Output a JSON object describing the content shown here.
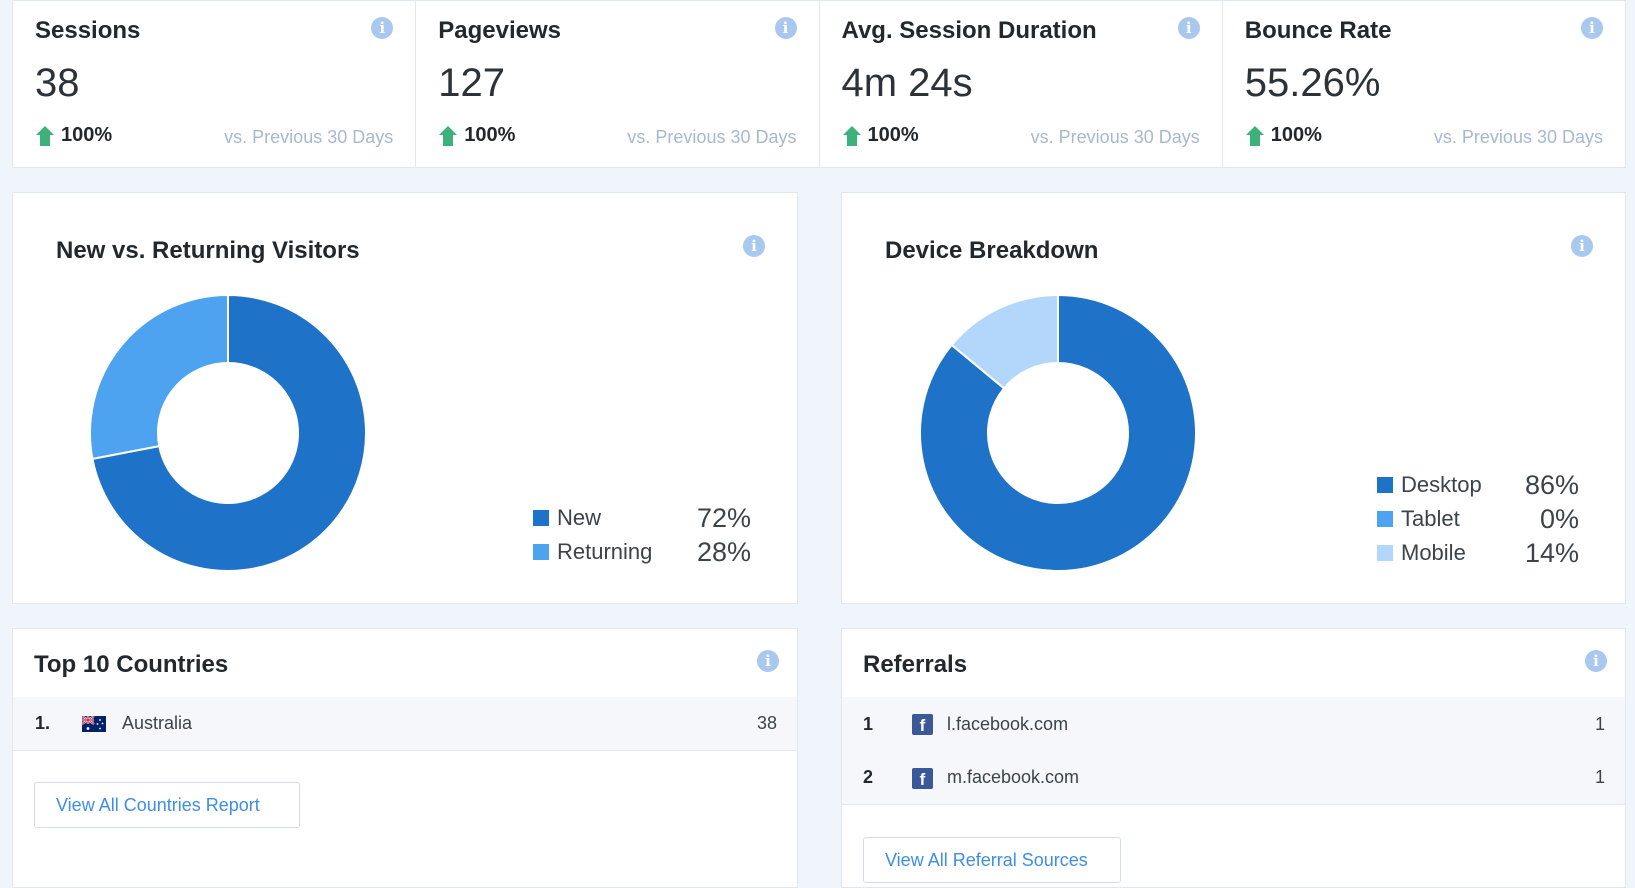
{
  "stats": [
    {
      "title": "Sessions",
      "value": "38",
      "change": "100%",
      "compare": "vs. Previous 30 Days"
    },
    {
      "title": "Pageviews",
      "value": "127",
      "change": "100%",
      "compare": "vs. Previous 30 Days"
    },
    {
      "title": "Avg. Session Duration",
      "value": "4m 24s",
      "change": "100%",
      "compare": "vs. Previous 30 Days"
    },
    {
      "title": "Bounce Rate",
      "value": "55.26%",
      "change": "100%",
      "compare": "vs. Previous 30 Days"
    }
  ],
  "info_icon_glyph": "i",
  "visitors": {
    "title": "New vs. Returning Visitors",
    "legend": [
      {
        "label": "New",
        "pct": "72%",
        "value": 72,
        "color": "#1e73c8"
      },
      {
        "label": "Returning",
        "pct": "28%",
        "value": 28,
        "color": "#4da3f0"
      }
    ]
  },
  "devices": {
    "title": "Device Breakdown",
    "legend": [
      {
        "label": "Desktop",
        "pct": "86%",
        "value": 86,
        "color": "#1e73c8"
      },
      {
        "label": "Tablet",
        "pct": "0%",
        "value": 0,
        "color": "#4da3f0"
      },
      {
        "label": "Mobile",
        "pct": "14%",
        "value": 14,
        "color": "#b3d7fb"
      }
    ]
  },
  "countries": {
    "title": "Top 10 Countries",
    "rows": [
      {
        "index": "1.",
        "name": "Australia",
        "count": "38",
        "flag_icon": "australia-flag-icon"
      }
    ],
    "button": "View All Countries Report"
  },
  "referrals": {
    "title": "Referrals",
    "rows": [
      {
        "index": "1",
        "name": "l.facebook.com",
        "count": "1",
        "icon": "facebook-icon"
      },
      {
        "index": "2",
        "name": "m.facebook.com",
        "count": "1",
        "icon": "facebook-icon"
      }
    ],
    "button": "View All Referral Sources"
  },
  "facebook_glyph": "f",
  "colors": {
    "accent": "#1e73c8",
    "positive": "#3cb17a",
    "muted": "#a8b8cf",
    "link": "#3d8ee6"
  }
}
